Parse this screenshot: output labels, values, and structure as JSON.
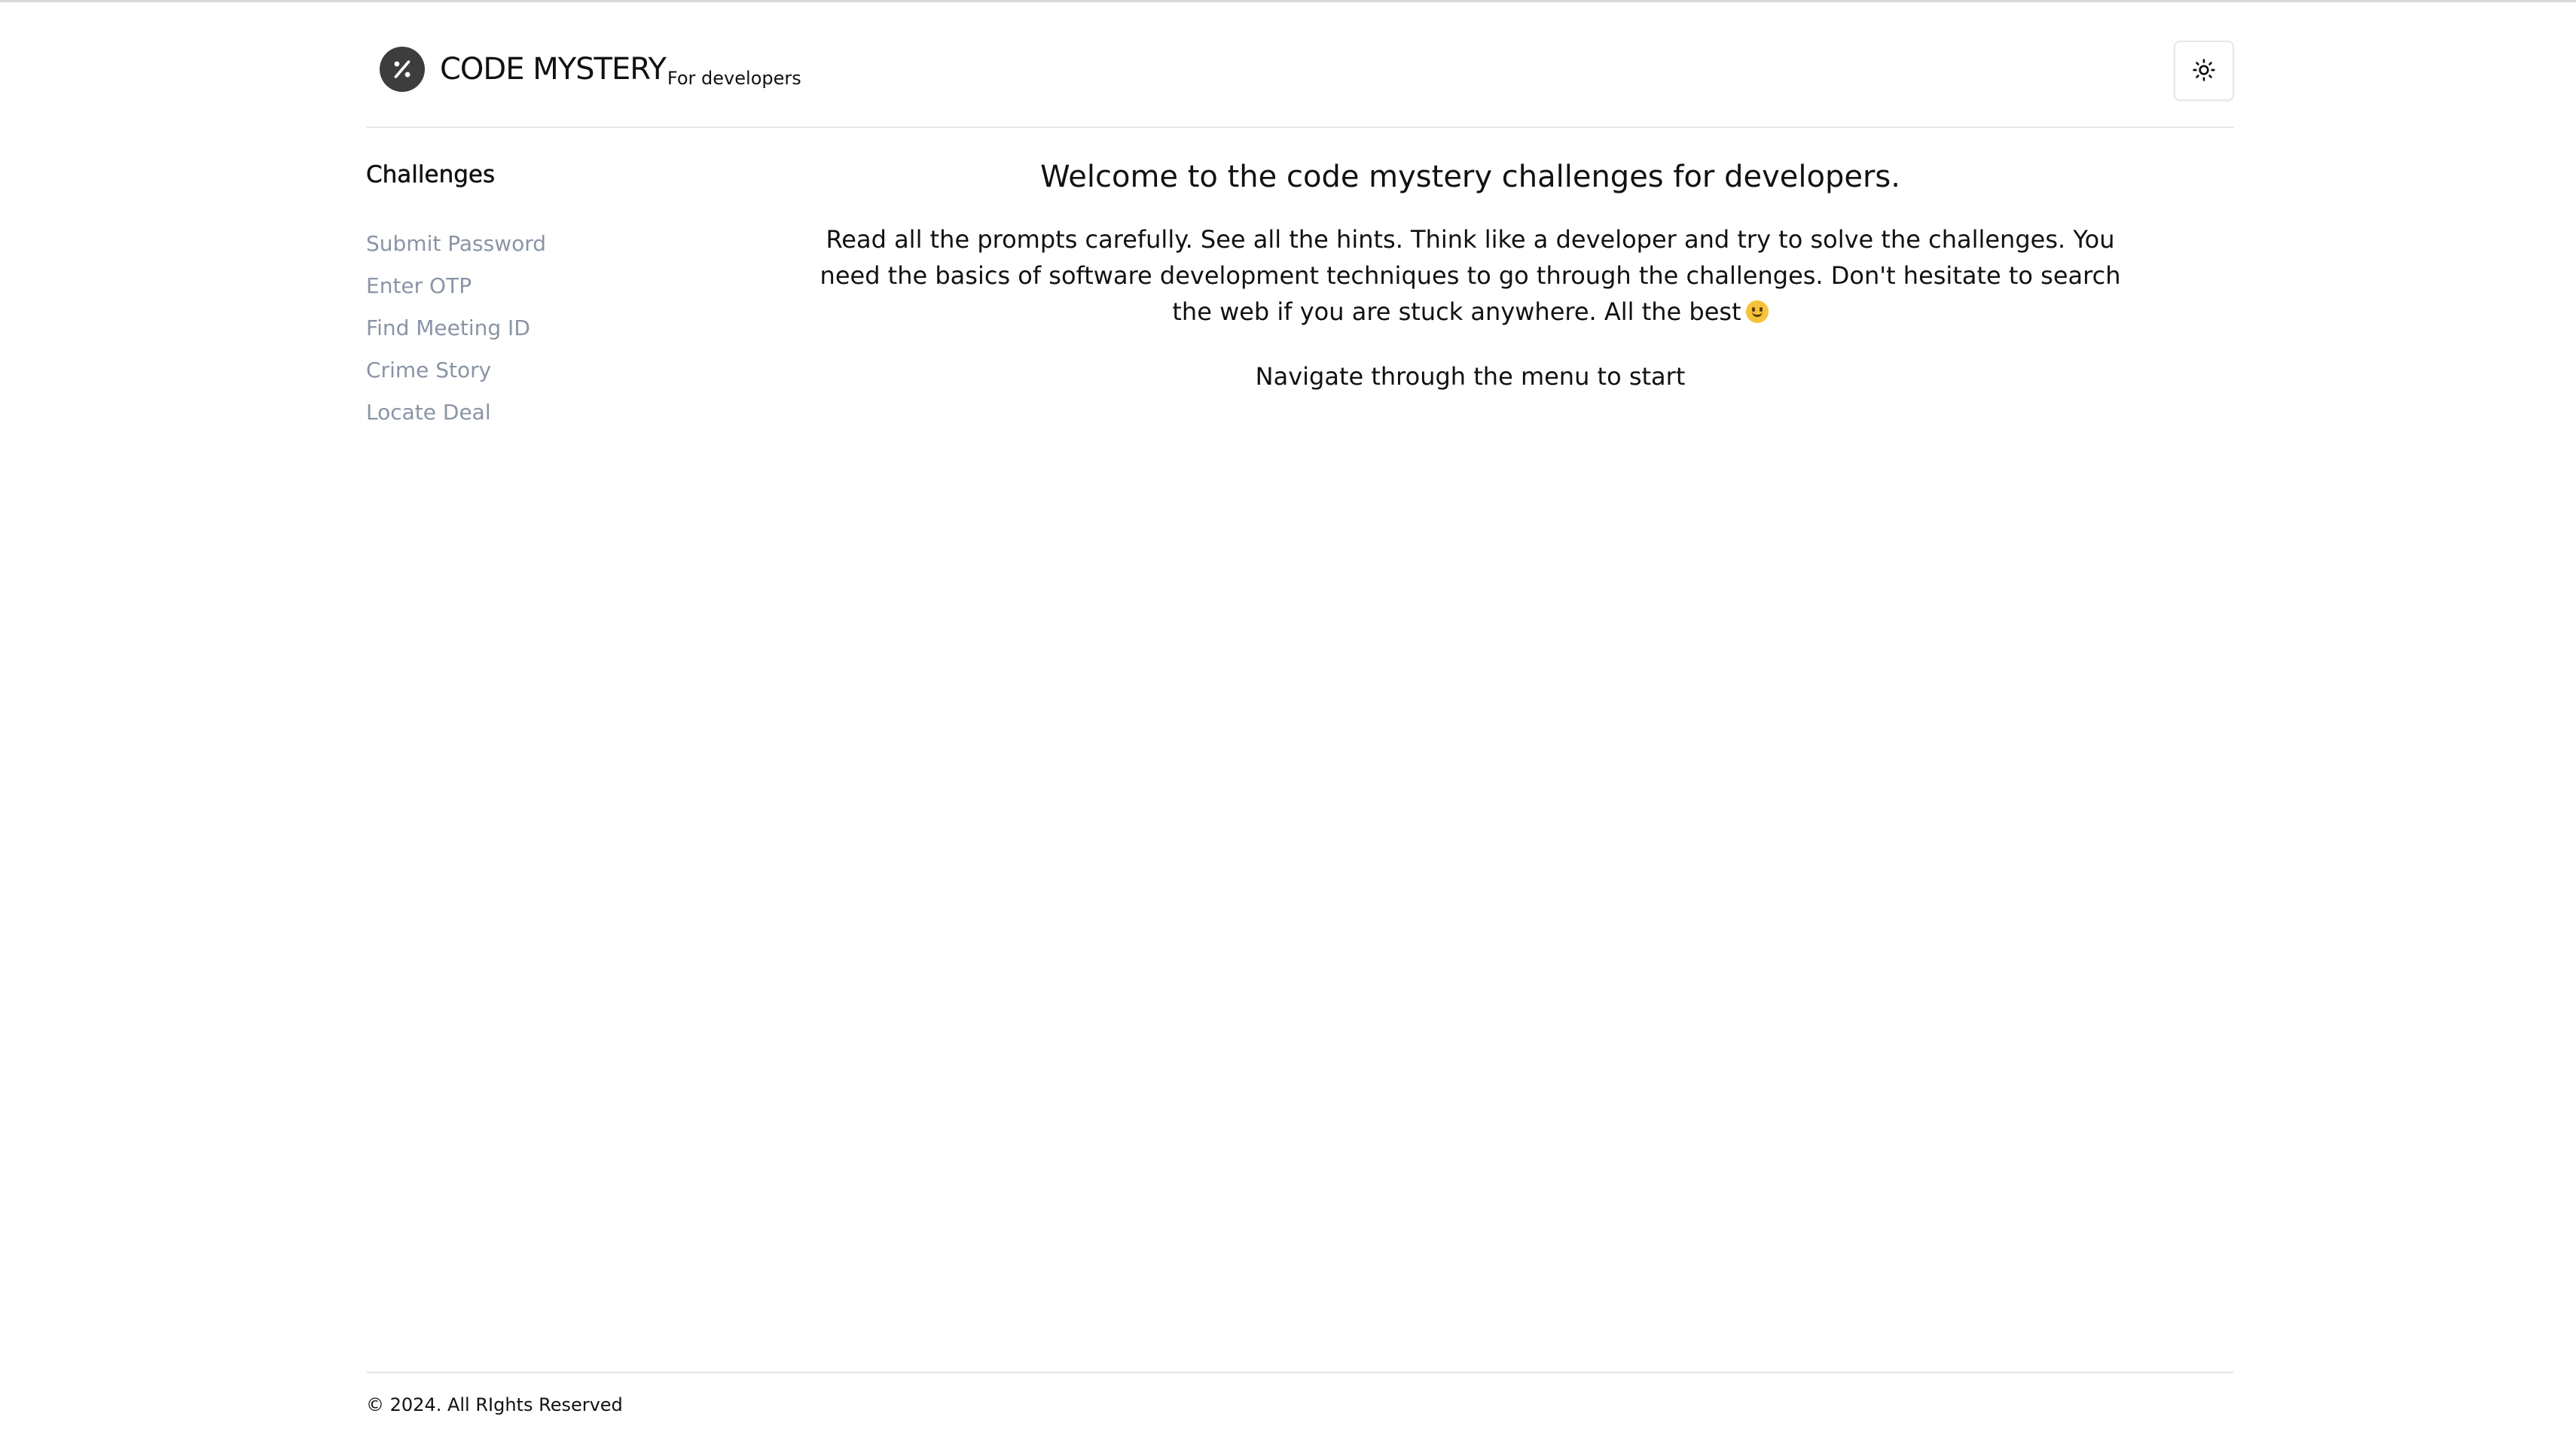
{
  "header": {
    "brand": "CODE MYSTERY",
    "brand_sub": "For developers",
    "logo_icon": "percent-icon",
    "theme_toggle_icon": "sun-icon"
  },
  "sidebar": {
    "title": "Challenges",
    "items": [
      {
        "label": "Submit Password"
      },
      {
        "label": "Enter OTP"
      },
      {
        "label": "Find Meeting ID"
      },
      {
        "label": "Crime Story"
      },
      {
        "label": "Locate Deal"
      }
    ]
  },
  "main": {
    "title": "Welcome to the code mystery challenges for developers.",
    "intro": "Read all the prompts carefully. See all the hints. Think like a developer and try to solve the challenges. You need the basics of software development techniques to go through the challenges. Don't hesitate to search the web if you are stuck anywhere. All the best",
    "intro_emoji": "smile-emoji",
    "nav_hint": "Navigate through the menu to start"
  },
  "footer": {
    "copyright": "© 2024. All RIghts Reserved"
  },
  "colors": {
    "sidebar_link": "#8a94a6",
    "logo_bg": "#3d3d3d",
    "divider": "#e5e7eb"
  }
}
